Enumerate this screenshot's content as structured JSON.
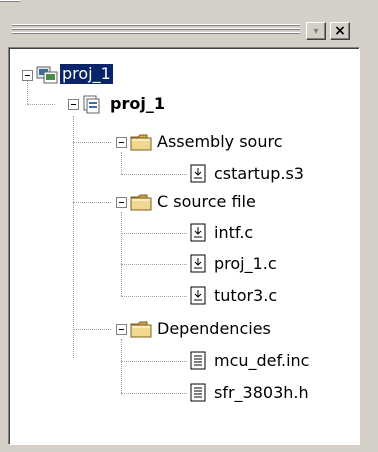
{
  "window": {
    "hide_button_glyph": "▾",
    "close_button_glyph": "×"
  },
  "tree": {
    "workspace": {
      "label": "proj_1",
      "icon": "workspace-icon",
      "selected": true
    },
    "project": {
      "label": "proj_1",
      "icon": "project-icon"
    },
    "groups": [
      {
        "label": "Assembly sourc",
        "icon": "folder-icon",
        "files": [
          {
            "label": "cstartup.s3",
            "icon": "source-file-icon"
          }
        ]
      },
      {
        "label": "C source file",
        "icon": "folder-icon",
        "files": [
          {
            "label": "intf.c",
            "icon": "source-file-icon"
          },
          {
            "label": "proj_1.c",
            "icon": "source-file-icon"
          },
          {
            "label": "tutor3.c",
            "icon": "source-file-icon"
          }
        ]
      },
      {
        "label": "Dependencies",
        "icon": "folder-icon",
        "files": [
          {
            "label": "mcu_def.inc",
            "icon": "header-file-icon"
          },
          {
            "label": "sfr_3803h.h",
            "icon": "header-file-icon"
          }
        ]
      }
    ]
  },
  "colors": {
    "panel_bg": "#d4d0c8",
    "selection_bg": "#0a246a",
    "selection_text": "#ffffff",
    "folder": "#f0d890"
  }
}
